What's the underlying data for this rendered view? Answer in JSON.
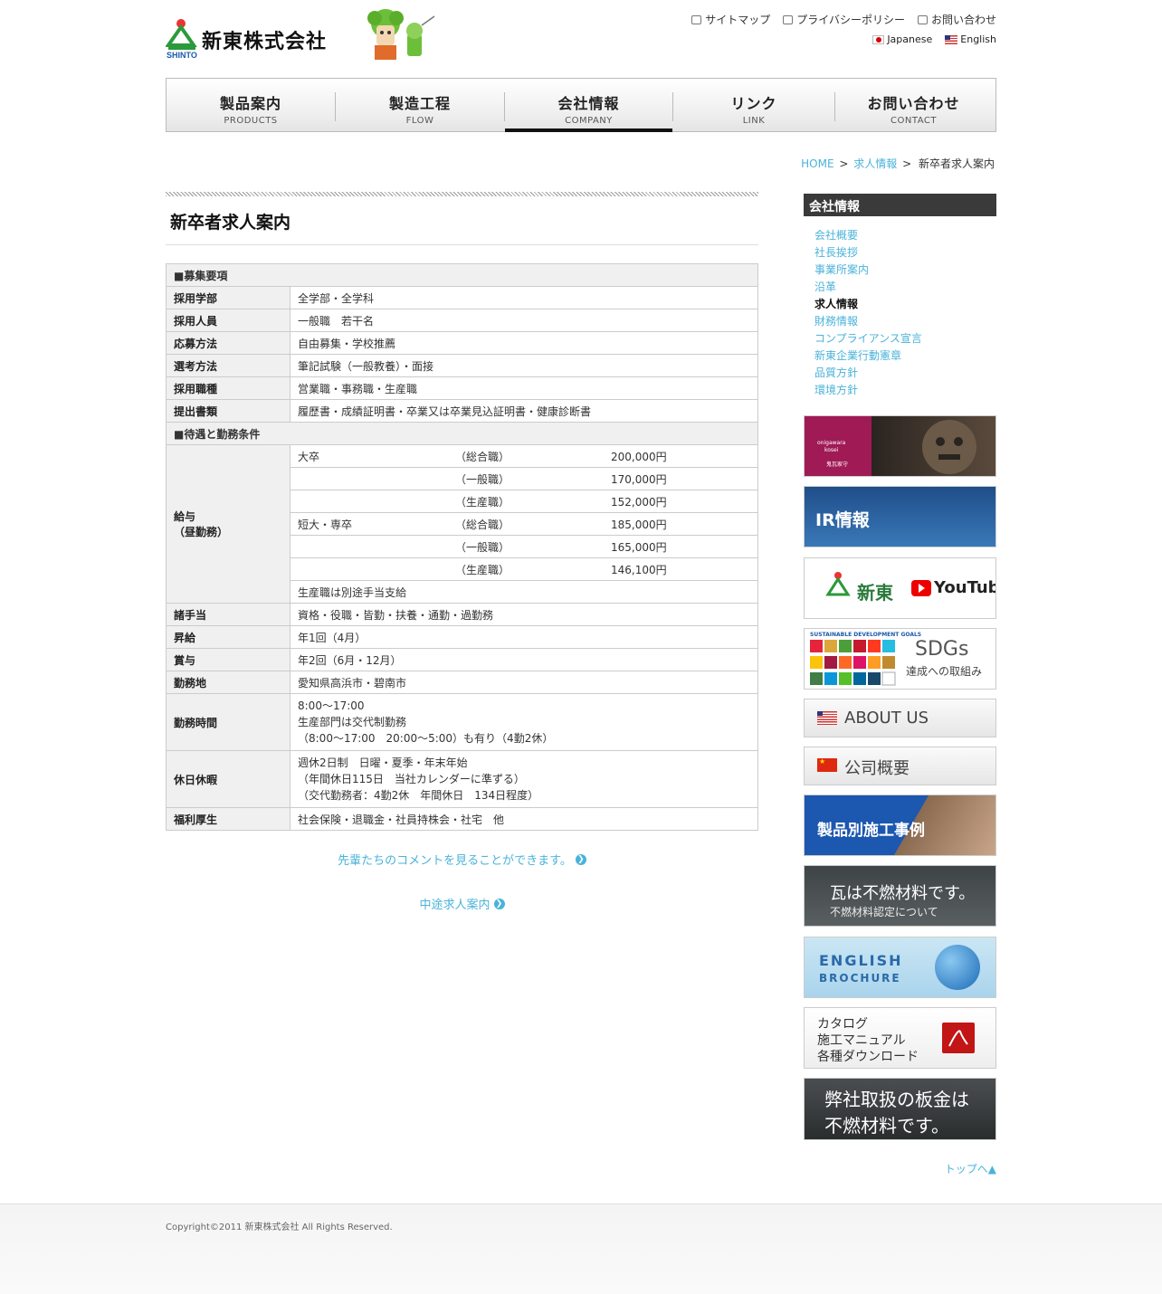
{
  "header": {
    "company_name": "新東株式会社",
    "logo_sub": "SHINTO",
    "top_links": [
      "サイトマップ",
      "プライバシーポリシー",
      "お問い合わせ"
    ],
    "languages": [
      "Japanese",
      "English"
    ]
  },
  "nav": [
    {
      "jp": "製品案内",
      "en": "PRODUCTS"
    },
    {
      "jp": "製造工程",
      "en": "FLOW"
    },
    {
      "jp": "会社情報",
      "en": "COMPANY"
    },
    {
      "jp": "リンク",
      "en": "LINK"
    },
    {
      "jp": "お問い合わせ",
      "en": "CONTACT"
    }
  ],
  "breadcrumb": {
    "home": "HOME",
    "sep": ">",
    "parent": "求人情報",
    "current": "新卒者求人案内"
  },
  "page_title": "新卒者求人案内",
  "table": {
    "section1": "■募集要項",
    "rows1": [
      {
        "label": "採用学部",
        "value": "全学部・全学科"
      },
      {
        "label": "採用人員",
        "value": "一般職　若干名"
      },
      {
        "label": "応募方法",
        "value": "自由募集・学校推薦"
      },
      {
        "label": "選考方法",
        "value": "筆記試験（一般教養）・面接"
      },
      {
        "label": "採用職種",
        "value": "営業職・事務職・生産職"
      },
      {
        "label": "提出書類",
        "value": "履歴書・成績証明書・卒業又は卒業見込証明書・健康診断書"
      }
    ],
    "section2": "■待遇と勤務条件",
    "salary_label_1": "給与",
    "salary_label_2": "（昼勤務）",
    "salary": [
      {
        "school": "大卒",
        "type": "（総合職）",
        "amount": "200,000円"
      },
      {
        "school": "",
        "type": "（一般職）",
        "amount": "170,000円"
      },
      {
        "school": "",
        "type": "（生産職）",
        "amount": "152,000円"
      },
      {
        "school": "短大・専卒",
        "type": "（総合職）",
        "amount": "185,000円"
      },
      {
        "school": "",
        "type": "（一般職）",
        "amount": "165,000円"
      },
      {
        "school": "",
        "type": "（生産職）",
        "amount": "146,100円"
      }
    ],
    "salary_note": "生産職は別途手当支給",
    "rows2": [
      {
        "label": "諸手当",
        "value": "資格・役職・皆勤・扶養・通勤・過勤務"
      },
      {
        "label": "昇給",
        "value": "年1回（4月）"
      },
      {
        "label": "賞与",
        "value": "年2回（6月・12月）"
      },
      {
        "label": "勤務地",
        "value": "愛知県高浜市・碧南市"
      }
    ],
    "hours": {
      "label": "勤務時間",
      "lines": [
        "8:00～17:00",
        "生産部門は交代制勤務",
        "（8:00～17:00　20:00～5:00）も有り（4勤2休）"
      ]
    },
    "holiday": {
      "label": "休日休暇",
      "lines": [
        "週休2日制　日曜・夏季・年末年始",
        "（年間休日115日　当社カレンダーに準ずる）",
        "（交代勤務者：4勤2休　年間休日　134日程度）"
      ]
    },
    "welfare": {
      "label": "福利厚生",
      "value": "社会保険・退職金・社員持株会・社宅　他"
    }
  },
  "links": {
    "comments": "先輩たちのコメントを見ることができます。",
    "midcareer": "中途求人案内"
  },
  "sidebar": {
    "heading": "会社情報",
    "items": [
      "会社概要",
      "社長挨拶",
      "事業所案内",
      "沿革",
      "求人情報",
      "財務情報",
      "コンプライアンス宣言",
      "新東企業行動憲章",
      "品質方針",
      "環境方針"
    ],
    "current_index": 4
  },
  "banners": {
    "onigawara_1": "onigawara",
    "onigawara_2": "kosei",
    "onigawara_3": "鬼瓦家守",
    "ir": "IR情報",
    "youtube_name": "新東",
    "youtube_logo": "YouTube",
    "sdgs_small": "SUSTAINABLE DEVELOPMENT GOALS",
    "sdgs_title": "SDGs",
    "sdgs_sub": "達成への取組み",
    "about_us": "ABOUT US",
    "china": "公司概要",
    "cases": "製品別施工事例",
    "fireproof_1": "瓦は不燃材料です。",
    "fireproof_2": "不燃材料認定について",
    "english_1": "ENGLISH",
    "english_2": "BROCHURE",
    "catalog_1": "カタログ",
    "catalog_2": "施工マニュアル",
    "catalog_3": "各種ダウンロード",
    "sheet_1": "弊社取扱の板金は",
    "sheet_2": "不燃材料です。"
  },
  "pagetop": "トップへ▲",
  "footer": {
    "copyright": "Copyright©2011 新東株式会社 All Rights Reserved."
  },
  "colors": {
    "link": "#4ab3d9",
    "heading_bar": "#3a3a3a",
    "table_header": "#f0f0f0"
  }
}
